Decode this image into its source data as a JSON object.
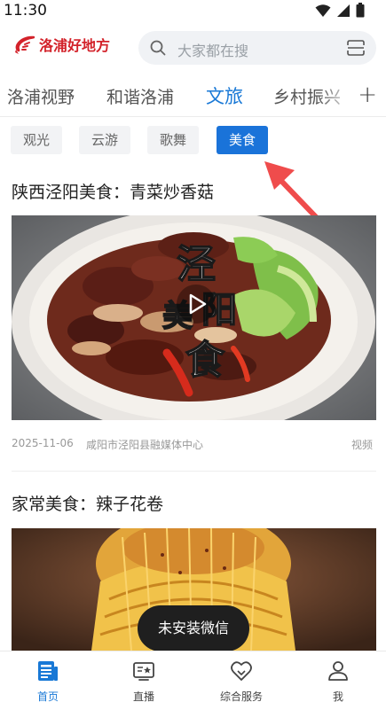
{
  "status_bar": {
    "time": "11:30"
  },
  "header": {
    "logo_text": "洛浦好地方",
    "search_placeholder": "大家都在搜"
  },
  "channels": {
    "tabs": [
      {
        "label": "洛浦视野"
      },
      {
        "label": "和谐洛浦"
      },
      {
        "label": "文旅",
        "active": true
      },
      {
        "label": "乡村振兴"
      }
    ],
    "add_icon": "plus-icon"
  },
  "subtabs": [
    {
      "label": "观光"
    },
    {
      "label": "云游"
    },
    {
      "label": "歌舞"
    },
    {
      "label": "美食",
      "active": true
    }
  ],
  "articles": [
    {
      "title": "陕西泾阳美食：青菜炒香菇",
      "overlay_text": [
        "泾",
        "阳",
        "美",
        "食"
      ],
      "date": "2025-11-06",
      "source": "咸阳市泾阳县融媒体中心",
      "type": "视频"
    },
    {
      "title": "家常美食：辣子花卷"
    }
  ],
  "toast": {
    "text": "未安装微信"
  },
  "bottom_nav": [
    {
      "label": "首页",
      "icon": "news-icon",
      "active": true
    },
    {
      "label": "直播",
      "icon": "live-tv-icon"
    },
    {
      "label": "综合服务",
      "icon": "service-heart-icon"
    },
    {
      "label": "我",
      "icon": "user-icon"
    }
  ],
  "colors": {
    "accent": "#1878d6",
    "brand_red": "#d3222a",
    "arrow_red": "#ef4c4c"
  }
}
